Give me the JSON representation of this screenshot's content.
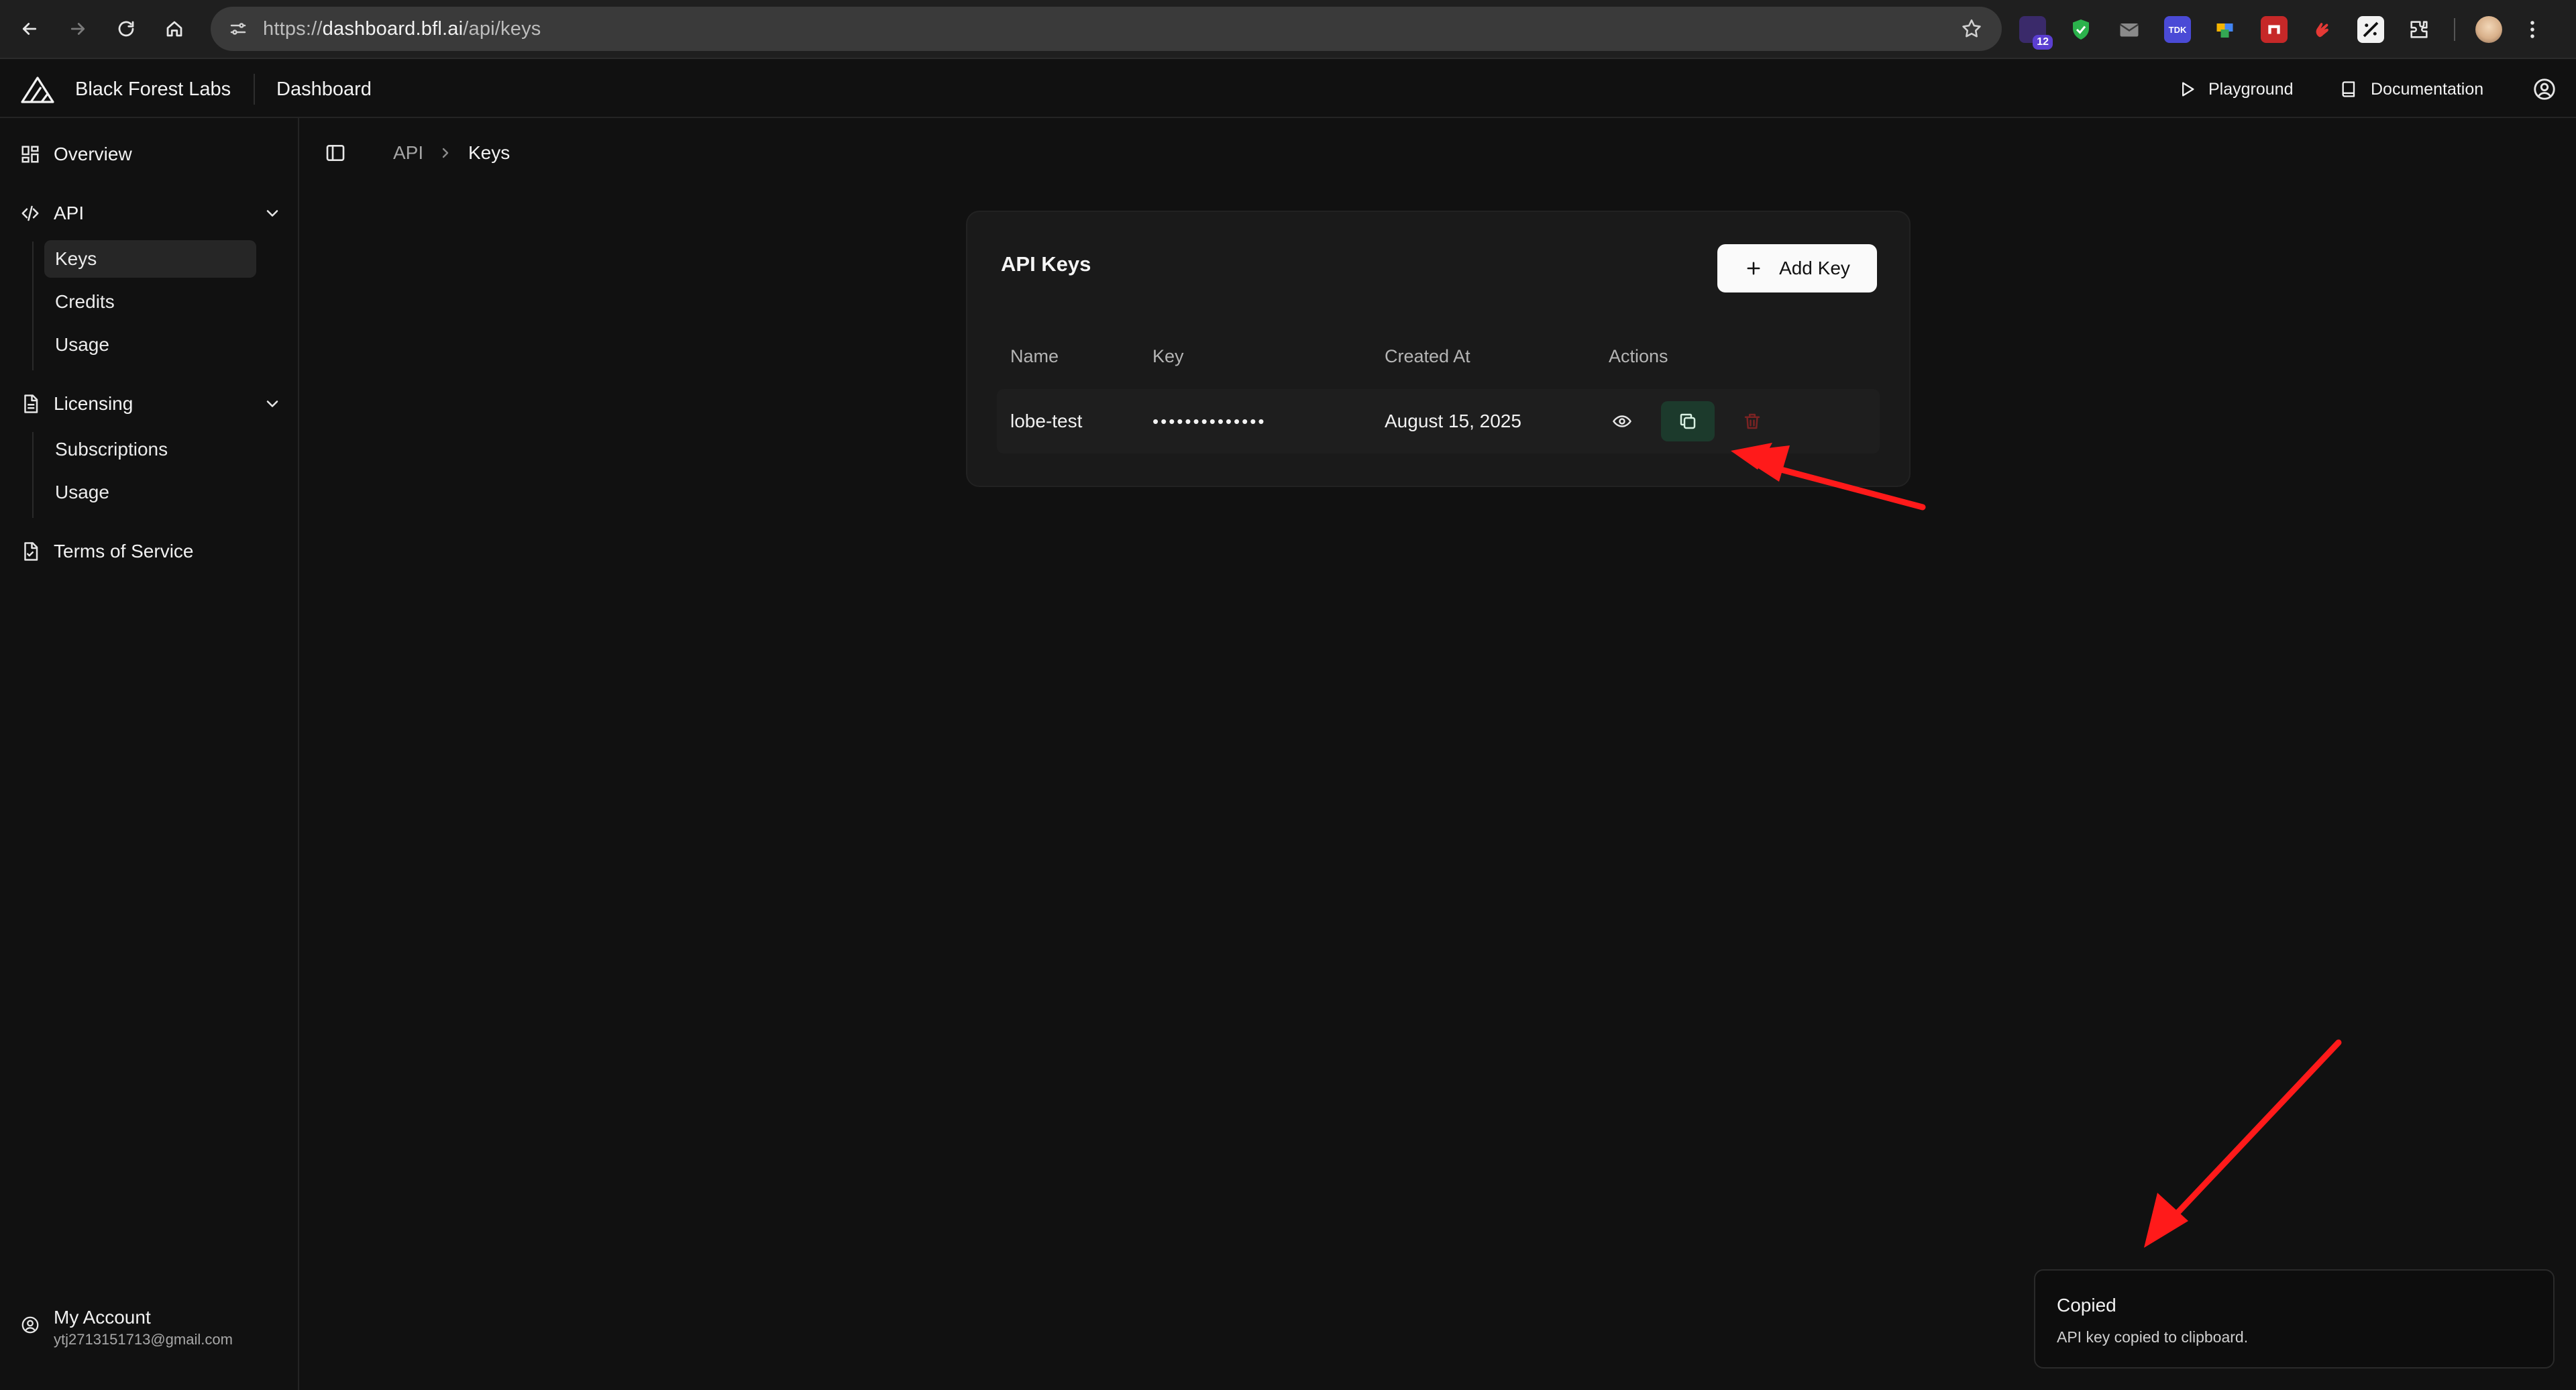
{
  "browser": {
    "url_scheme": "https://",
    "url_host": "dashboard.bfl.ai",
    "url_path": "/api/keys",
    "extension_badge": "12",
    "extension_tdk": "TDK"
  },
  "header": {
    "brand": "Black Forest Labs",
    "title": "Dashboard",
    "playground": "Playground",
    "documentation": "Documentation"
  },
  "sidebar": {
    "overview": "Overview",
    "api": {
      "label": "API",
      "items": [
        "Keys",
        "Credits",
        "Usage"
      ]
    },
    "licensing": {
      "label": "Licensing",
      "items": [
        "Subscriptions",
        "Usage"
      ]
    },
    "terms": "Terms of Service",
    "account": {
      "label": "My Account",
      "email": "ytj2713151713@gmail.com"
    }
  },
  "breadcrumb": {
    "parent": "API",
    "current": "Keys"
  },
  "api_keys_card": {
    "title": "API Keys",
    "add_button": "Add Key",
    "columns": [
      "Name",
      "Key",
      "Created At",
      "Actions"
    ],
    "rows": [
      {
        "name": "lobe-test",
        "key": "••••••••••••••",
        "created_at": "August 15, 2025"
      }
    ]
  },
  "toast": {
    "title": "Copied",
    "description": "API key copied to clipboard."
  },
  "colors": {
    "background": "#111111",
    "card": "#1a1a1a",
    "copy_button": "#1c3a2c",
    "delete_icon": "#7a2323",
    "annotation_arrow": "#ff1a1a"
  }
}
